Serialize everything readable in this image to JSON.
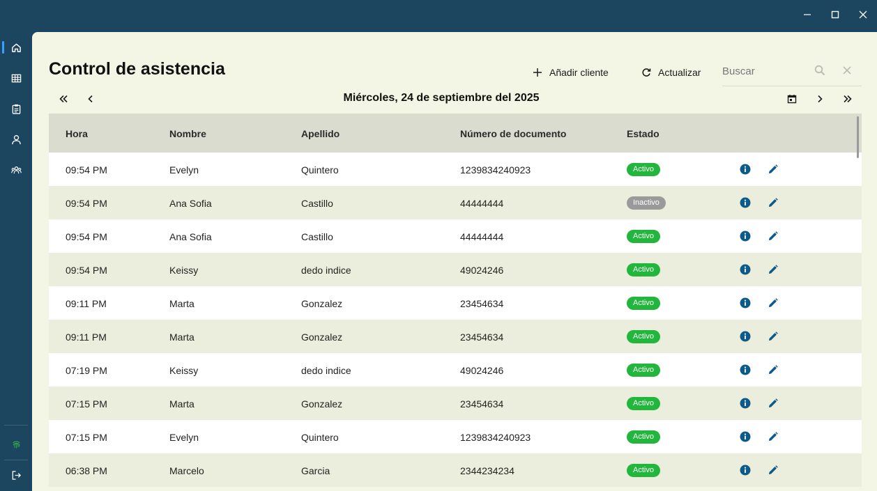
{
  "window": {
    "minimize_icon": "minimize-icon",
    "maximize_icon": "maximize-icon",
    "close_icon": "close-icon"
  },
  "sidebar": {
    "items": [
      {
        "id": "home",
        "icon": "home-icon",
        "active": true
      },
      {
        "id": "table",
        "icon": "grid-icon",
        "active": false
      },
      {
        "id": "clipboard",
        "icon": "clipboard-icon",
        "active": false
      },
      {
        "id": "user",
        "icon": "user-icon",
        "active": false
      },
      {
        "id": "group",
        "icon": "group-icon",
        "active": false
      }
    ],
    "bottom": [
      {
        "id": "fingerprint",
        "icon": "fingerprint-icon",
        "color": "#2fae4a"
      },
      {
        "id": "logout",
        "icon": "logout-icon"
      }
    ]
  },
  "header": {
    "title": "Control de asistencia",
    "add_label": "Añadir cliente",
    "refresh_label": "Actualizar",
    "search_placeholder": "Buscar",
    "date": "Miércoles, 24 de septiembre del 2025"
  },
  "table": {
    "columns": [
      "Hora",
      "Nombre",
      "Apellido",
      "Número de documento",
      "Estado"
    ],
    "rows": [
      {
        "hora": "09:54 PM",
        "nombre": "Evelyn",
        "apellido": "Quintero",
        "documento": "1239834240923",
        "estado": "Activo"
      },
      {
        "hora": "09:54 PM",
        "nombre": "Ana Sofia",
        "apellido": "Castillo",
        "documento": "44444444",
        "estado": "Inactivo"
      },
      {
        "hora": "09:54 PM",
        "nombre": "Ana Sofia",
        "apellido": "Castillo",
        "documento": "44444444",
        "estado": "Activo"
      },
      {
        "hora": "09:54 PM",
        "nombre": "Keissy",
        "apellido": "dedo indice",
        "documento": "49024246",
        "estado": "Activo"
      },
      {
        "hora": "09:11 PM",
        "nombre": "Marta",
        "apellido": "Gonzalez",
        "documento": "23454634",
        "estado": "Activo"
      },
      {
        "hora": "09:11 PM",
        "nombre": "Marta",
        "apellido": "Gonzalez",
        "documento": "23454634",
        "estado": "Activo"
      },
      {
        "hora": "07:19 PM",
        "nombre": "Keissy",
        "apellido": "dedo indice",
        "documento": "49024246",
        "estado": "Activo"
      },
      {
        "hora": "07:15 PM",
        "nombre": "Marta",
        "apellido": "Gonzalez",
        "documento": "23454634",
        "estado": "Activo"
      },
      {
        "hora": "07:15 PM",
        "nombre": "Evelyn",
        "apellido": "Quintero",
        "documento": "1239834240923",
        "estado": "Activo"
      },
      {
        "hora": "06:38 PM",
        "nombre": "Marcelo",
        "apellido": "Garcia",
        "documento": "2344234234",
        "estado": "Activo"
      }
    ]
  },
  "colors": {
    "sidebar_bg": "#1c4660",
    "panel_bg": "#f3f6e5",
    "active_badge": "#22b63d",
    "inactive_badge": "#9a9a9a",
    "action_icon": "#0e5a8a"
  }
}
